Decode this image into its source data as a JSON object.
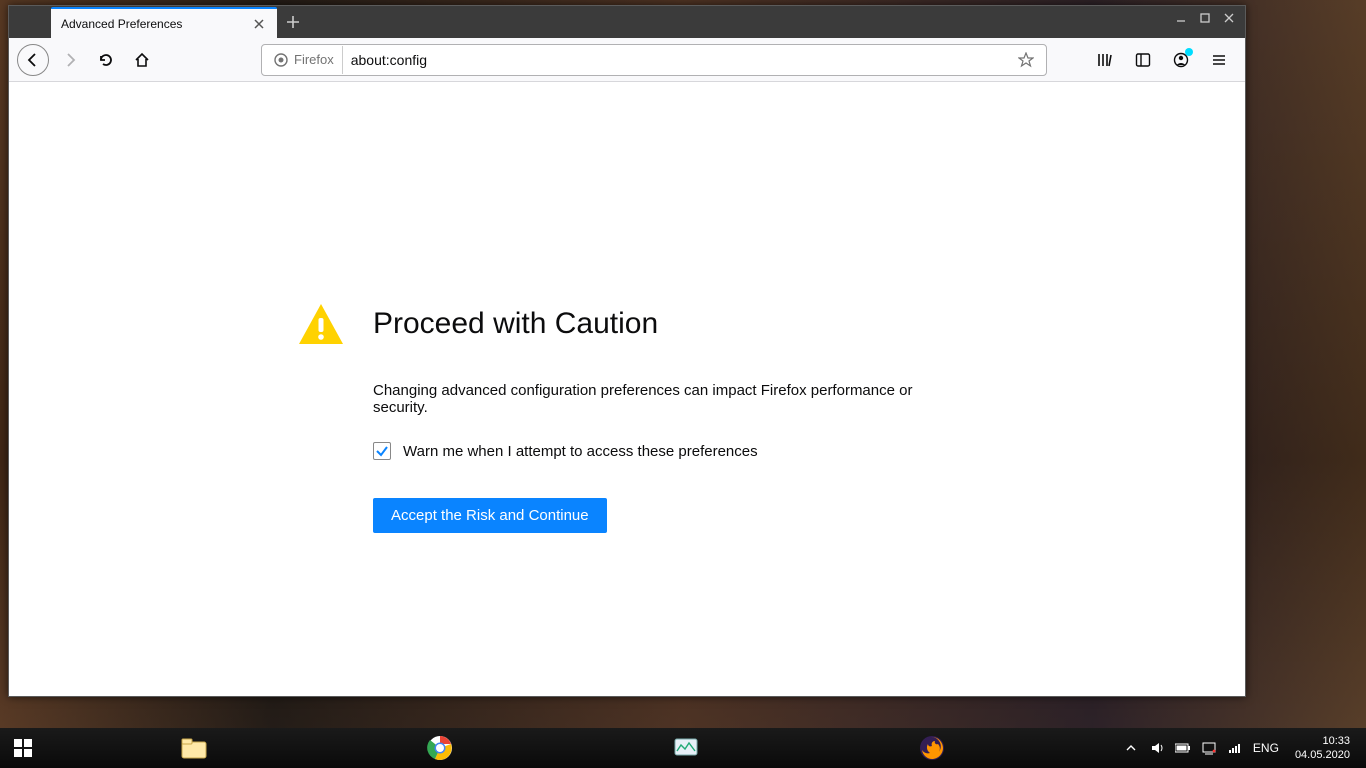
{
  "window": {
    "tab_title": "Advanced Preferences",
    "url_identity": "Firefox",
    "url": "about:config"
  },
  "page": {
    "heading": "Proceed with Caution",
    "description": "Changing advanced configuration preferences can impact Firefox performance or security.",
    "checkbox_label": "Warn me when I attempt to access these preferences",
    "checkbox_checked": true,
    "accept_button": "Accept the Risk and Continue"
  },
  "taskbar": {
    "language": "ENG",
    "time": "10:33",
    "date": "04.05.2020"
  }
}
